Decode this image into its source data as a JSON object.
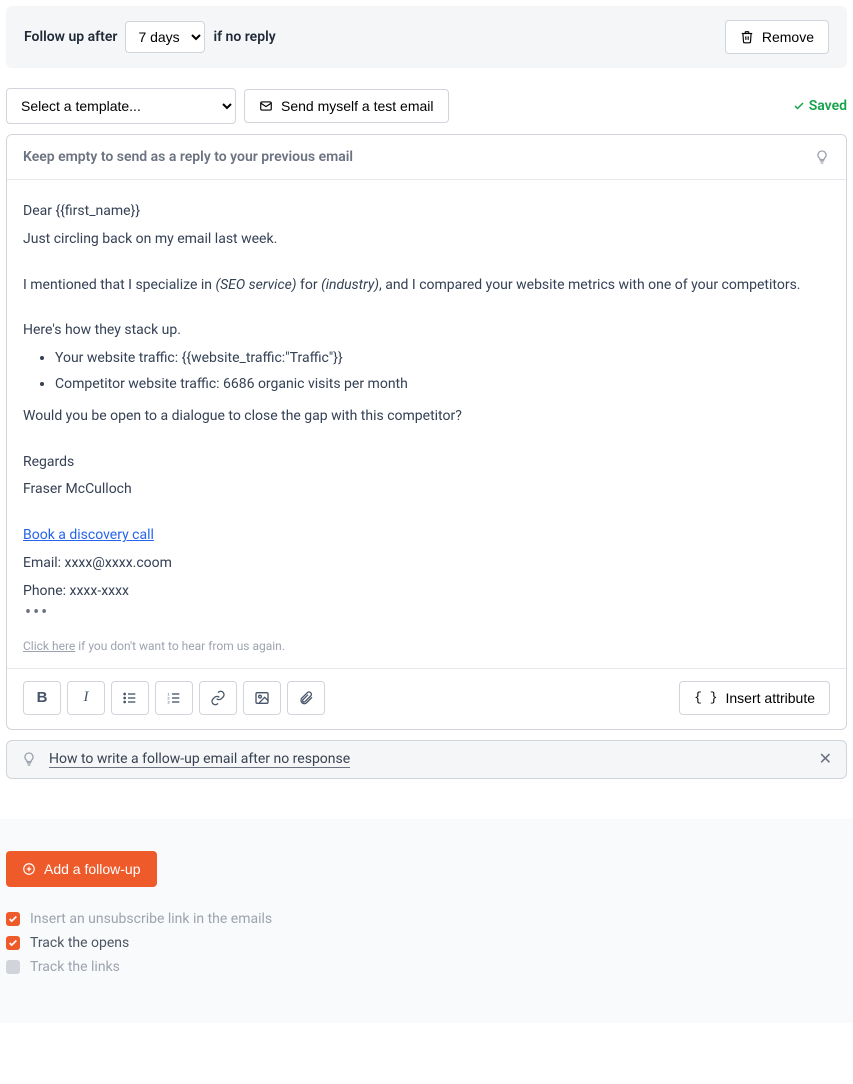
{
  "followup_bar": {
    "prefix_label": "Follow up after",
    "days_value": "7 days",
    "suffix_label": "if no reply",
    "remove_label": "Remove"
  },
  "controls": {
    "template_placeholder": "Select a template...",
    "test_email_label": "Send myself a test email",
    "saved_label": "Saved"
  },
  "editor": {
    "subject_placeholder": "Keep empty to send as a reply to your previous email",
    "body": {
      "greeting": "Dear {{first_name}}",
      "line2": "Just circling back on my email last week.",
      "paragraph1_a": "I mentioned that I specialize in ",
      "paragraph1_seo": "(SEO service)",
      "paragraph1_b": " for ",
      "paragraph1_industry": "(industry)",
      "paragraph1_c": ", and I compared your website metrics with one of your competitors.",
      "line4": "Here's how they stack up.",
      "bullet1": "Your website traffic: {{website_traffic:\"Traffic\"}}",
      "bullet2": "Competitor website traffic: 6686 organic visits  per month",
      "line5": "Would you be open to a dialogue to close the gap with this competitor?",
      "regards": "Regards",
      "signature_name": "Fraser McCulloch",
      "cta_link": "Book a discovery call",
      "email_line": "Email: xxxx@xxxx.coom",
      "phone_line": "Phone: xxxx-xxxx",
      "dots": "•••",
      "unsub_click": "Click here",
      "unsub_rest": " if you don't want to hear from us again."
    },
    "insert_attribute_label": "Insert attribute"
  },
  "tip": {
    "text": "How to write a follow-up email after no response"
  },
  "footer": {
    "add_followup": "Add a follow-up",
    "chk_unsub": "Insert an unsubscribe link in the emails",
    "chk_opens": "Track the opens",
    "chk_links": "Track the links"
  }
}
